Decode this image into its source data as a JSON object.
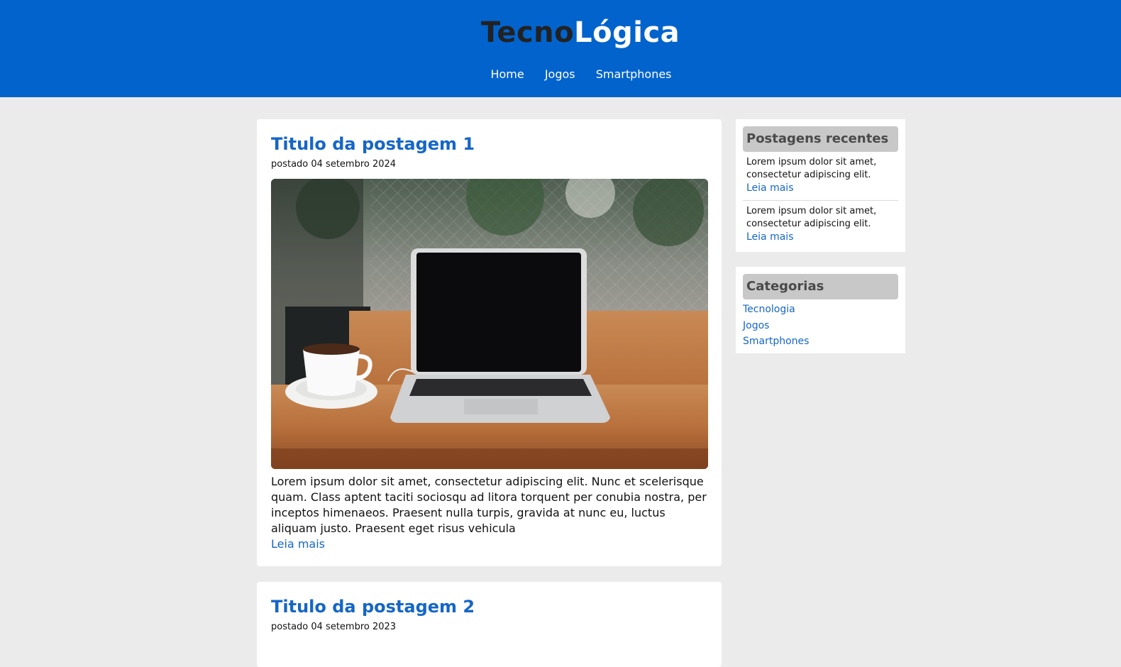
{
  "header": {
    "logo_part1": "Tecno",
    "logo_part2": "Lógica",
    "nav": [
      "Home",
      "Jogos",
      "Smartphones"
    ],
    "colors": {
      "background": "#0263cc",
      "logo_dark": "#222222",
      "logo_light": "#ffffff"
    }
  },
  "posts": [
    {
      "title": "Titulo da postagem 1",
      "date": "postado 04 setembro 2024",
      "image": "laptop-coffee-photo",
      "text": "Lorem ipsum dolor sit amet, consectetur adipiscing elit. Nunc et scelerisque quam. Class aptent taciti sociosqu ad litora torquent per conubia nostra, per inceptos himenaeos. Praesent nulla turpis, gravida at nunc eu, luctus aliquam justo. Praesent eget risus vehicula",
      "read_more": "Leia mais"
    },
    {
      "title": "Titulo da postagem 2",
      "date": "postado 04 setembro 2023"
    }
  ],
  "sidebar": {
    "recent": {
      "title": "Postagens recentes",
      "items": [
        {
          "text": "Lorem ipsum dolor sit amet, consectetur adipiscing elit.",
          "link": "Leia mais"
        },
        {
          "text": "Lorem ipsum dolor sit amet, consectetur adipiscing elit.",
          "link": "Leia mais"
        }
      ]
    },
    "categories": {
      "title": "Categorias",
      "items": [
        "Tecnologia",
        "Jogos",
        "Smartphones"
      ]
    }
  },
  "colors": {
    "accent": "#1566c7",
    "page_bg": "#ebebeb",
    "widget_title_bg": "#c8c8c8"
  }
}
